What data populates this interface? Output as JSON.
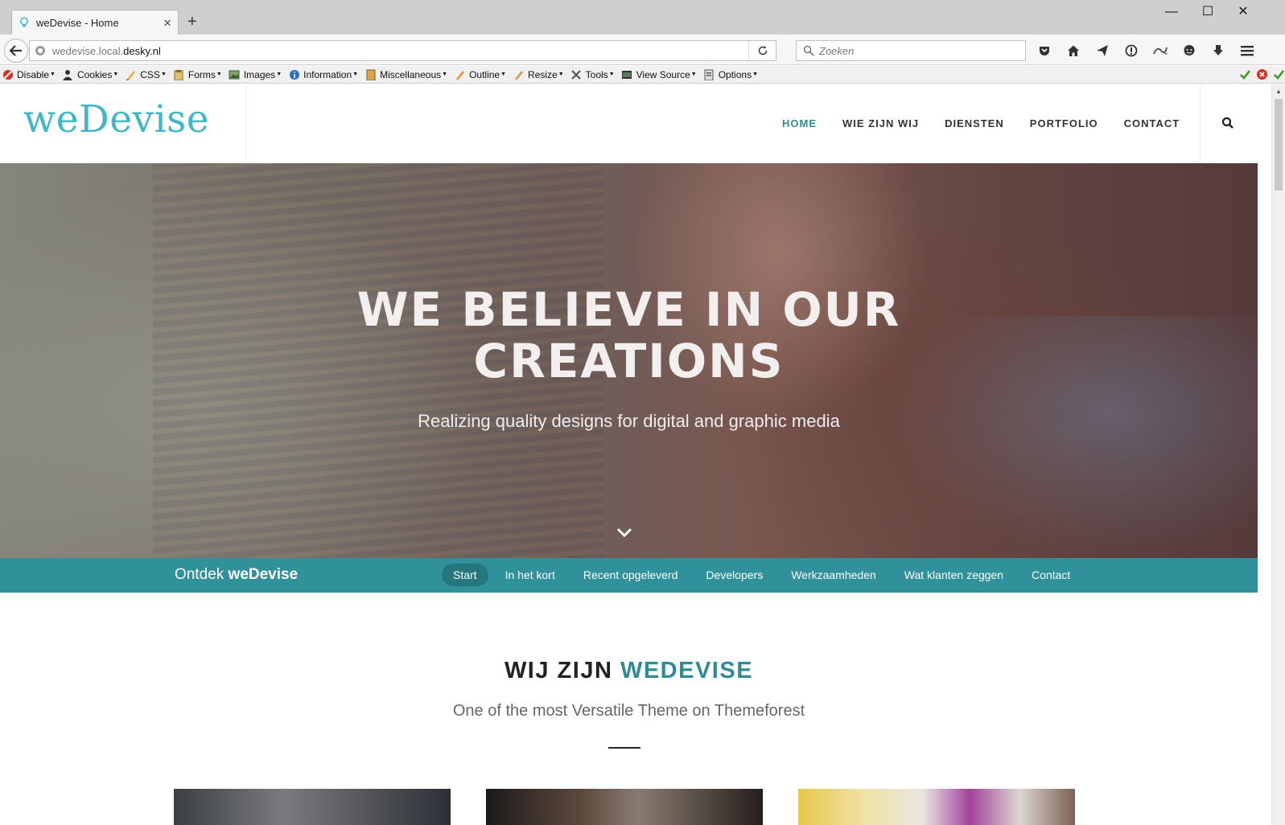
{
  "browser": {
    "tab_title": "weDevise - Home",
    "url_prefix": "wedevise.local.",
    "url_host": "desky.nl",
    "search_placeholder": "Zoeken",
    "window_controls": {
      "minimize": "—",
      "maximize": "☐",
      "close": "✕"
    },
    "toolbar_icons": [
      "pocket-icon",
      "home-icon",
      "send-icon",
      "info-icon",
      "extension-icon",
      "chat-icon",
      "download-icon",
      "menu-icon"
    ]
  },
  "devbar": {
    "items": [
      {
        "label": "Disable",
        "icon": "disable-icon"
      },
      {
        "label": "Cookies",
        "icon": "cookies-icon"
      },
      {
        "label": "CSS",
        "icon": "css-icon"
      },
      {
        "label": "Forms",
        "icon": "forms-icon"
      },
      {
        "label": "Images",
        "icon": "images-icon"
      },
      {
        "label": "Information",
        "icon": "information-icon"
      },
      {
        "label": "Miscellaneous",
        "icon": "miscellaneous-icon"
      },
      {
        "label": "Outline",
        "icon": "outline-icon"
      },
      {
        "label": "Resize",
        "icon": "resize-icon"
      },
      {
        "label": "Tools",
        "icon": "tools-icon"
      },
      {
        "label": "View Source",
        "icon": "view-source-icon"
      },
      {
        "label": "Options",
        "icon": "options-icon"
      }
    ]
  },
  "site": {
    "logo": "weDevise",
    "nav": [
      {
        "label": "HOME",
        "active": true
      },
      {
        "label": "WIE ZIJN WIJ",
        "active": false
      },
      {
        "label": "DIENSTEN",
        "active": false
      },
      {
        "label": "PORTFOLIO",
        "active": false
      },
      {
        "label": "CONTACT",
        "active": false
      }
    ],
    "hero": {
      "title_line1": "WE BELIEVE IN OUR",
      "title_line2": "CREATIONS",
      "subtitle": "Realizing quality designs for digital and graphic media"
    },
    "subnav": {
      "brand_prefix": "Ontdek ",
      "brand_bold": "weDevise",
      "links": [
        "Start",
        "In het kort",
        "Recent opgeleverd",
        "Developers",
        "Werkzaamheden",
        "Wat klanten zeggen",
        "Contact"
      ],
      "active_index": 0
    },
    "intro": {
      "title_plain": "WIJ ZIJN ",
      "title_accent": "WEDEVISE",
      "subtitle": "One of the most Versatile Theme on Themeforest"
    }
  },
  "colors": {
    "brand_teal": "#31919a",
    "logo_cyan": "#3fb7c9",
    "nav_active": "#2f8c97"
  }
}
